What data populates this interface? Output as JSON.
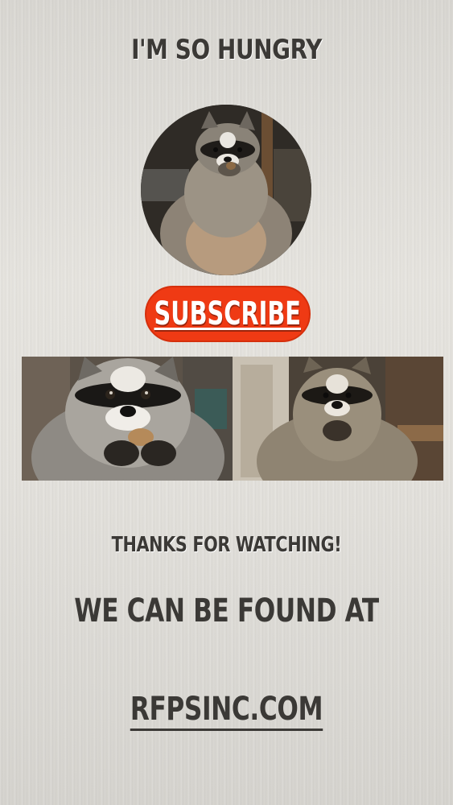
{
  "title": "I'M SO HUNGRY",
  "subscribe_label": "SUBSCRIBE",
  "thanks": "THANKS FOR WATCHING!",
  "found_at": "WE CAN BE FOUND AT",
  "website": "RFPSINC.COM",
  "colors": {
    "background": "#e3e1dc",
    "text": "#3b3936",
    "subscribe_bg": "#ef3a14",
    "subscribe_text": "#ffffff"
  }
}
